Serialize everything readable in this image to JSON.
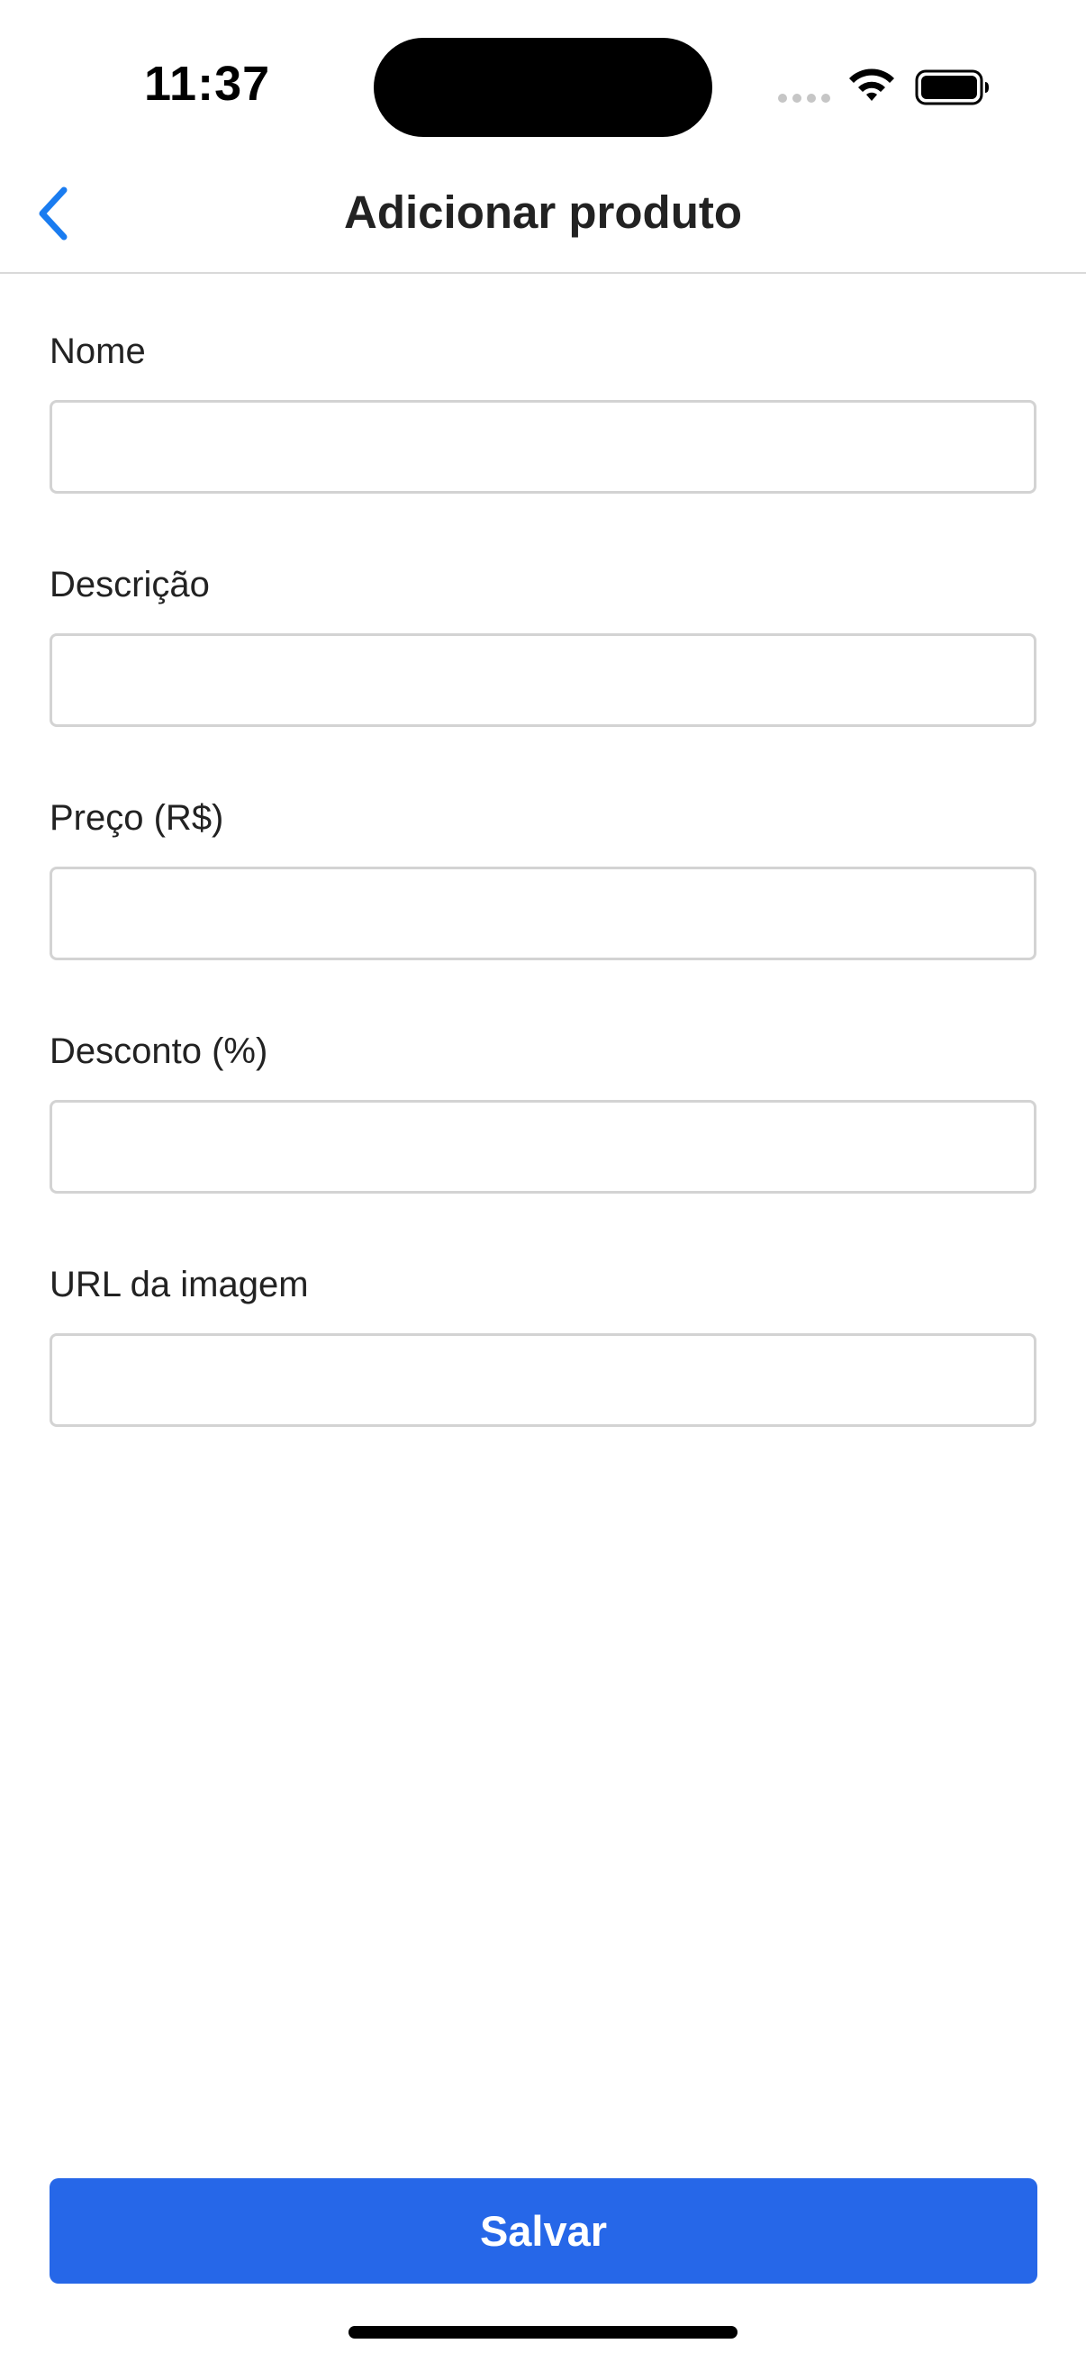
{
  "status_bar": {
    "time": "11:37",
    "icons": [
      "cellular-signal-icon",
      "wifi-icon",
      "battery-icon"
    ]
  },
  "nav": {
    "back_icon": "chevron-left-icon",
    "title": "Adicionar produto"
  },
  "form": {
    "fields": [
      {
        "label": "Nome",
        "value": "",
        "placeholder": ""
      },
      {
        "label": "Descrição",
        "value": "",
        "placeholder": ""
      },
      {
        "label": "Preço (R$)",
        "value": "",
        "placeholder": ""
      },
      {
        "label": "Desconto (%)",
        "value": "",
        "placeholder": ""
      },
      {
        "label": "URL da imagem",
        "value": "",
        "placeholder": ""
      }
    ]
  },
  "actions": {
    "save_label": "Salvar"
  },
  "colors": {
    "accent": "#2667e8",
    "back_chevron": "#1a7cf0",
    "text": "#222222",
    "input_border": "#d3d3d3"
  }
}
